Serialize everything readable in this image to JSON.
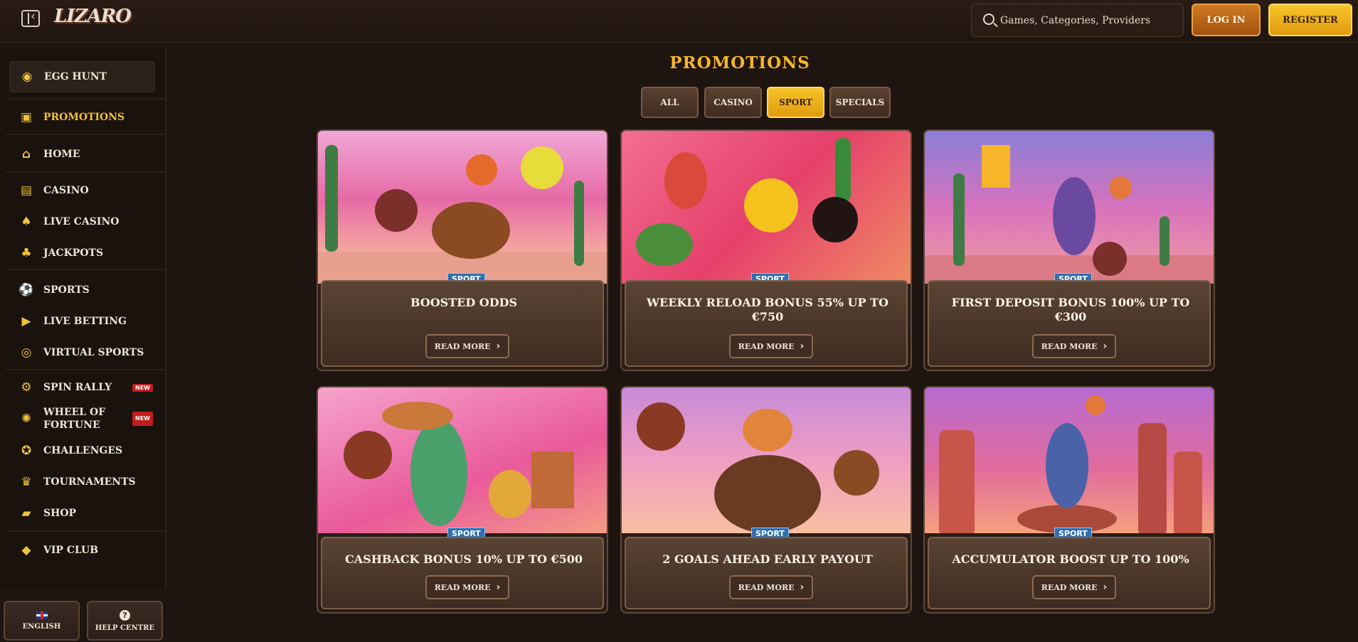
{
  "header": {
    "logo": "LIZARO",
    "search_placeholder": "Games, Categories, Providers",
    "login_label": "LOG IN",
    "register_label": "REGISTER"
  },
  "sidebar": {
    "items": [
      {
        "label": "EGG HUNT",
        "icon": "egg-icon"
      },
      {
        "label": "PROMOTIONS",
        "icon": "gift-icon"
      },
      {
        "label": "HOME",
        "icon": "home-icon"
      },
      {
        "label": "CASINO",
        "icon": "casino-icon"
      },
      {
        "label": "LIVE CASINO",
        "icon": "cards-icon"
      },
      {
        "label": "JACKPOTS",
        "icon": "clover-icon"
      },
      {
        "label": "SPORTS",
        "icon": "ball-icon"
      },
      {
        "label": "LIVE BETTING",
        "icon": "play-icon"
      },
      {
        "label": "VIRTUAL SPORTS",
        "icon": "virtual-icon"
      },
      {
        "label": "SPIN RALLY",
        "icon": "car-icon",
        "badge": "NEW"
      },
      {
        "label": "WHEEL OF FORTUNE",
        "icon": "wheel-icon",
        "badge": "NEW"
      },
      {
        "label": "CHALLENGES",
        "icon": "medal-icon"
      },
      {
        "label": "TOURNAMENTS",
        "icon": "trophy-icon"
      },
      {
        "label": "SHOP",
        "icon": "bag-icon"
      },
      {
        "label": "VIP CLUB",
        "icon": "diamond-icon"
      }
    ],
    "language_label": "ENGLISH",
    "help_label": "HELP CENTRE"
  },
  "main": {
    "title": "PROMOTIONS",
    "tabs": [
      "ALL",
      "CASINO",
      "SPORT",
      "SPECIALS"
    ],
    "selected_tab": "SPORT",
    "read_more_label": "READ MORE",
    "cards": [
      {
        "tag": "SPORT",
        "title": "BOOSTED ODDS"
      },
      {
        "tag": "SPORT",
        "title": "WEEKLY RELOAD BONUS 55% UP TO €750"
      },
      {
        "tag": "SPORT",
        "title": "FIRST DEPOSIT BONUS 100% UP TO €300"
      },
      {
        "tag": "SPORT",
        "title": "CASHBACK BONUS 10% UP TO €500"
      },
      {
        "tag": "SPORT",
        "title": "2 GOALS AHEAD EARLY PAYOUT"
      },
      {
        "tag": "SPORT",
        "title": "ACCUMULATOR BOOST UP TO 100%"
      }
    ]
  },
  "colors": {
    "accent": "#f6b62a",
    "background": "#1e1410",
    "tag_blue": "#2f6fb3",
    "badge_red": "#c21d1d"
  }
}
